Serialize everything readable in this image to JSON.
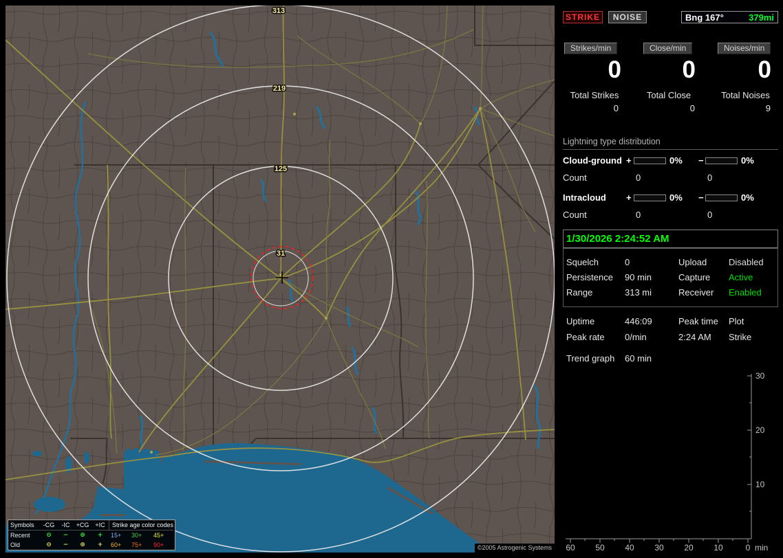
{
  "map": {
    "ring_labels": {
      "r1": "313",
      "r2": "219",
      "r3": "125",
      "r4": "31"
    },
    "legend": {
      "symbols_header": "Symbols",
      "col_neg_cg": "-CG",
      "col_neg_ic": "-IC",
      "col_pos_cg": "+CG",
      "col_pos_ic": "+IC",
      "age_header": "Strike age color codes",
      "recent_label": "Recent",
      "old_label": "Old",
      "sym_neg_cg": "⊖",
      "sym_neg_ic": "−",
      "sym_pos_cg": "⊕",
      "sym_pos_ic": "+",
      "recent_symbol_color": "#3ae23a",
      "old_symbol_color": "#d8d860",
      "ages_recent": [
        {
          "text": "15+",
          "color": "#7fb2ff"
        },
        {
          "text": "30+",
          "color": "#49d049"
        },
        {
          "text": "45+",
          "color": "#e6e63c"
        }
      ],
      "ages_old": [
        {
          "text": "60+",
          "color": "#ffb02e"
        },
        {
          "text": "75+",
          "color": "#ff7020"
        },
        {
          "text": "90+",
          "color": "#ff2828"
        }
      ]
    },
    "copyright": "©2005 Astrogenic Systems"
  },
  "panel": {
    "strike_button": "STRIKE",
    "noise_button": "NOISE",
    "bearing": {
      "label": "Bng 167°",
      "distance": "379mi",
      "distance_color": "#00ff30"
    },
    "counters": [
      {
        "label": "Strikes/min",
        "value": "0",
        "total_label": "Total Strikes",
        "total_value": "0"
      },
      {
        "label": "Close/min",
        "value": "0",
        "total_label": "Total Close",
        "total_value": "0"
      },
      {
        "label": "Noises/min",
        "value": "0",
        "total_label": "Total Noises",
        "total_value": "9"
      }
    ],
    "distribution": {
      "title": "Lightning type distribution",
      "rows": [
        {
          "label": "Cloud-ground",
          "plus_sign": "+",
          "plus_pct": "0%",
          "minus_sign": "−",
          "minus_pct": "0%",
          "count_label": "Count",
          "plus_count": "0",
          "minus_count": "0"
        },
        {
          "label": "Intracloud",
          "plus_sign": "+",
          "plus_pct": "0%",
          "minus_sign": "−",
          "minus_pct": "0%",
          "count_label": "Count",
          "plus_count": "0",
          "minus_count": "0"
        }
      ]
    },
    "timestamp": "1/30/2026 2:24:52 AM",
    "timestamp_color": "#00ff00",
    "settings_rows": [
      {
        "l1": "Squelch",
        "v1": "0",
        "l2": "Upload",
        "v2": "Disabled",
        "v2_color": "#dcdcdc"
      },
      {
        "l1": "Persistence",
        "v1": "90 min",
        "l2": "Capture",
        "v2": "Active",
        "v2_color": "#00dd00"
      },
      {
        "l1": "Range",
        "v1": "313 mi",
        "l2": "Receiver",
        "v2": "Enabled",
        "v2_color": "#00dd00"
      }
    ],
    "status_rows": [
      {
        "l1": "Uptime",
        "v1": "446:09",
        "l2": "Peak time",
        "v2": "Plot"
      },
      {
        "l1": "Peak rate",
        "v1": "0/min",
        "l2": "2:24 AM",
        "v2": "Strike"
      }
    ],
    "trend": {
      "label": "Trend graph",
      "value": "60 min"
    }
  },
  "chart_data": {
    "type": "line",
    "title": "Strike rate trend graph (last 60 min)",
    "x_ticks": [
      "60",
      "50",
      "40",
      "30",
      "20",
      "10",
      "0"
    ],
    "x_unit": "min",
    "x_axis_minutes_ago": [
      60,
      0
    ],
    "y_ticks": [
      "30",
      "20",
      "10"
    ],
    "ylim": [
      0,
      30
    ],
    "series": []
  }
}
